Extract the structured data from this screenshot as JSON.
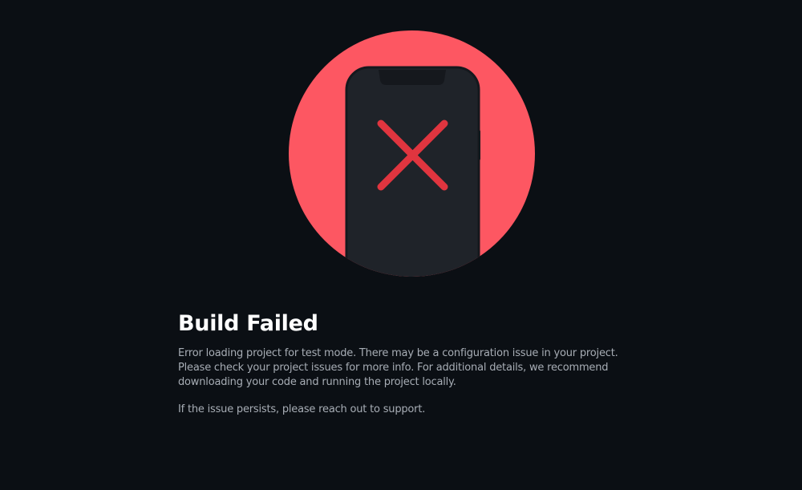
{
  "error": {
    "title": "Build Failed",
    "message": "Error loading project for test mode. There may be a configuration issue in your project. Please check your project issues for more info. For additional details, we recommend downloading your code and running the project locally.",
    "support_message": "If the issue persists, please reach out to support."
  },
  "illustration": {
    "icon": "phone-with-x-icon",
    "circle_color": "#fd5762",
    "phone_color": "#1f2329",
    "cross_color": "#e0353f"
  },
  "colors": {
    "background": "#0b0f14",
    "title": "#ffffff",
    "body_text": "#a7adb5"
  }
}
